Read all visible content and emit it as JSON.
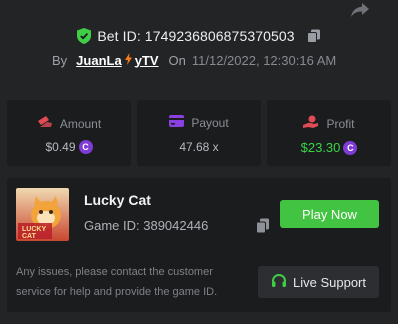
{
  "header": {
    "bet_label": "Bet ID: 1749236806875370503",
    "by_label": "By",
    "username_part1": "JuanLa",
    "username_part2": "yTV",
    "on_label": "On",
    "date": "11/12/2022, 12:30:16 AM"
  },
  "stats": {
    "amount_label": "Amount",
    "amount_value": "$0.49",
    "payout_label": "Payout",
    "payout_value": "47.68 x",
    "profit_label": "Profit",
    "profit_value": "$23.30",
    "coin_symbol": "C"
  },
  "game": {
    "name": "Lucky Cat",
    "id_label": "Game ID: 389042446",
    "thumbnail_text_line1": "LUCKY",
    "thumbnail_text_line2": "CAT",
    "play_button": "Play Now"
  },
  "support": {
    "issues_text": "Any issues, please contact the customer service for help and provide the game ID.",
    "button": "Live Support"
  },
  "colors": {
    "background": "#232426",
    "panel": "#1b1c1e",
    "green": "#42c442",
    "profit_green": "#38d646",
    "coin_purple": "#7e3bd6",
    "bolt_orange": "#ff7a1a"
  },
  "icons": [
    "share-icon",
    "shield-check-icon",
    "copy-icon",
    "amount-icon",
    "payout-icon",
    "profit-icon",
    "coin-icon",
    "headset-icon"
  ]
}
